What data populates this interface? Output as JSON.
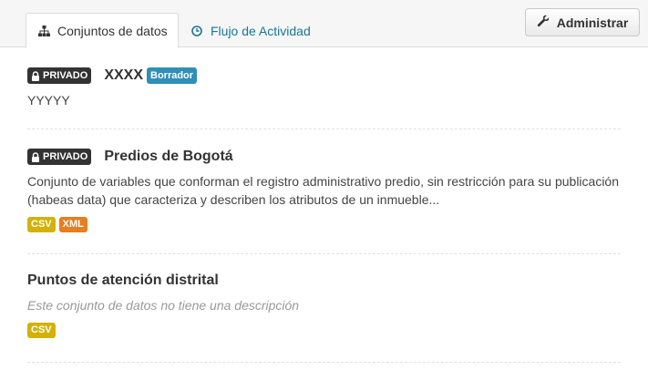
{
  "tabs": {
    "datasets_label": "Conjuntos de datos",
    "activity_label": "Flujo de Actividad"
  },
  "admin_button": {
    "label": "Administrar"
  },
  "datasets": [
    {
      "private_label": "PRIVADO",
      "title": "XXXX",
      "draft_label": "Borrador",
      "description": "YYYYY"
    },
    {
      "private_label": "PRIVADO",
      "title": "Predios de Bogotá",
      "description": "Conjunto de variables que conforman el registro administrativo predio, sin restricción para su publicación (habeas data) que caracteriza y describen los atributos de un inmueble...",
      "formats": [
        "CSV",
        "XML"
      ]
    },
    {
      "title": "Puntos de atención distrital",
      "description": "Este conjunto de datos no tiene una descripción",
      "formats": [
        "CSV"
      ]
    }
  ],
  "colors": {
    "csv": "#d4b106",
    "xml": "#e67e22",
    "draft": "#2f8fb7",
    "private": "#333333",
    "link": "#187794"
  }
}
